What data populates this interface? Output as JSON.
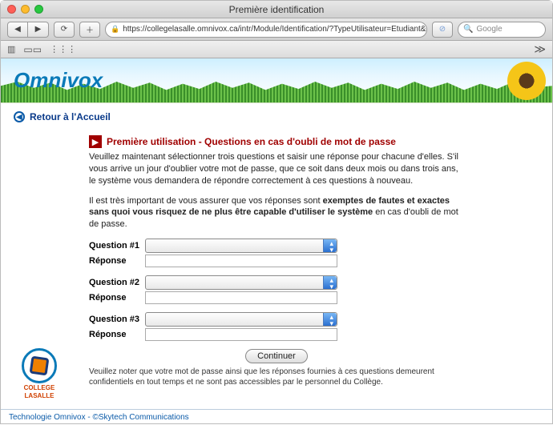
{
  "window": {
    "title": "Première identification"
  },
  "browser": {
    "url": "https://collegelasalle.omnivox.ca/intr/Module/Identification/?TypeUtilisateur=Etudiant&C=LAS",
    "search_placeholder": "Google",
    "reload_glyph": "⟳"
  },
  "banner": {
    "logo_text": "Omnivox"
  },
  "nav": {
    "return_label": "Retour à l'Accueil"
  },
  "main": {
    "heading": "Première utilisation - Questions en cas d'oubli de mot de passe",
    "intro": "Veuillez maintenant sélectionner trois questions et saisir une réponse pour chacune d'elles. S'il vous arrive un jour d'oublier votre mot de passe, que ce soit dans deux mois ou dans trois ans, le système vous demandera de répondre correctement à ces questions à nouveau.",
    "warn_pre": "Il est très important de vous assurer que vos réponses sont ",
    "warn_bold": "exemptes de fautes et exactes sans quoi vous risquez de ne plus être capable d'utiliser le système",
    "warn_post": " en cas d'oubli de mot de passe.",
    "questions": [
      {
        "q_label": "Question #1",
        "a_label": "Réponse"
      },
      {
        "q_label": "Question #2",
        "a_label": "Réponse"
      },
      {
        "q_label": "Question #3",
        "a_label": "Réponse"
      }
    ],
    "continue_label": "Continuer",
    "footnote": "Veuillez noter que votre mot de passe ainsi que les réponses fournies à ces questions demeurent confidentiels en tout temps et ne sont pas accessibles par le personnel du Collège."
  },
  "footer": {
    "college_line1": "COLLEGE",
    "college_line2": "LASALLE",
    "tech": "Technologie Omnivox - ©Skytech Communications"
  }
}
